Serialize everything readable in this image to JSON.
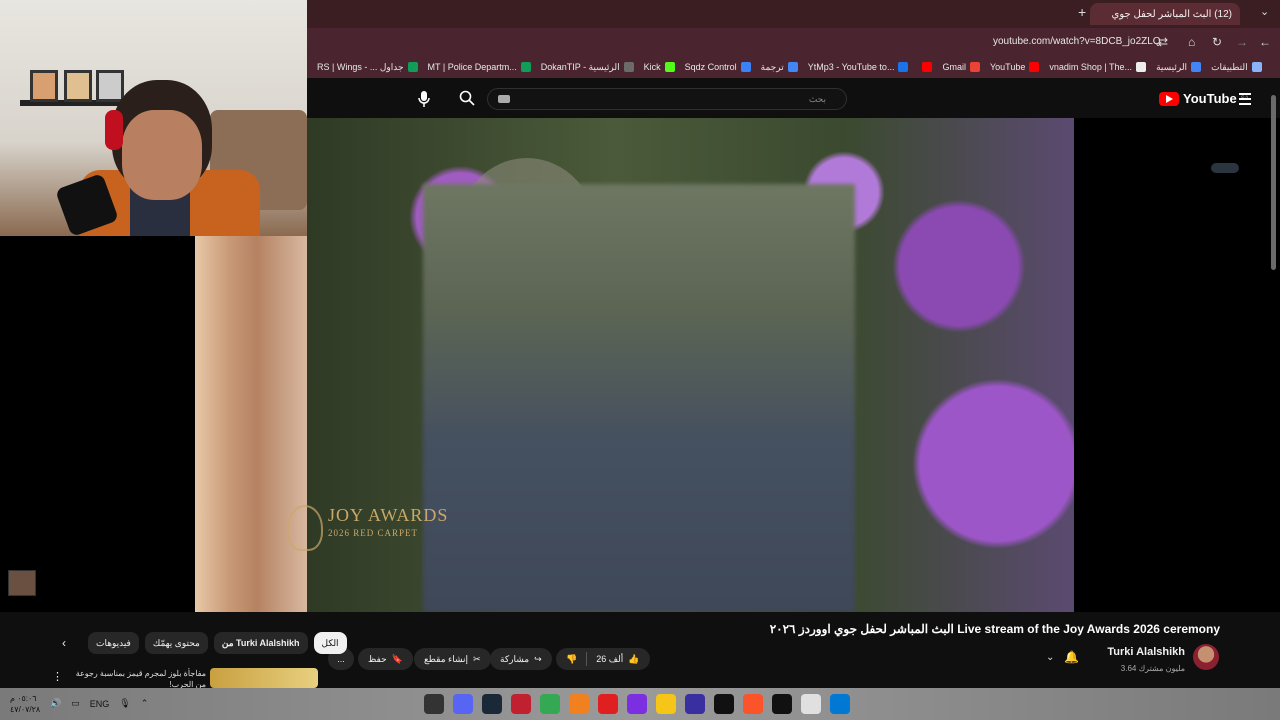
{
  "browser": {
    "tab_title": "(12) البث المباشر لحفل جوي",
    "url": "youtube.com/watch?v=8DCB_jo2ZLQ",
    "bookmarks": [
      {
        "label": "التطبيقات",
        "color": "#8ab4f8"
      },
      {
        "label": "الرئيسية",
        "color": "#4285f4"
      },
      {
        "label": "vnadim Shop | The...",
        "color": "#eeeeee"
      },
      {
        "label": "YouTube",
        "color": "#ff0000"
      },
      {
        "label": "Gmail",
        "color": "#ea4335"
      },
      {
        "label": "",
        "color": "#ff0000"
      },
      {
        "label": "YtMp3 - YouTube to...",
        "color": "#1a73e8"
      },
      {
        "label": "ترجمة",
        "color": "#4285f4"
      },
      {
        "label": "Sqdz Control",
        "color": "#3b82f6"
      },
      {
        "label": "Kick",
        "color": "#53fc18"
      },
      {
        "label": "DokanTIP - الرئيسية",
        "color": "#6b6b6b"
      },
      {
        "label": "MT | Police Departm...",
        "color": "#0f9d58"
      },
      {
        "label": "RS | Wings - ... جداول",
        "color": "#0f9d58"
      }
    ]
  },
  "youtube": {
    "logo": "YouTube",
    "region": "SA",
    "search_placeholder": "بحث",
    "title": "البث المباشر لحفل جوي اووردز ٢٠٢٦ Live stream of the Joy Awards 2026 ceremony",
    "channel_name": "Turki Alalshikh",
    "subscribers": "3.64 مليون مشترك",
    "likes": "26 ألف",
    "share_label": "مشاركة",
    "clip_label": "إنشاء مقطع",
    "save_label": "حفظ",
    "more_label": "...",
    "chips": [
      {
        "label": "الكل",
        "active": true
      },
      {
        "label": "من Turki Alalshikh",
        "active": false
      },
      {
        "label": "محتوى يهمّك",
        "active": false
      },
      {
        "label": "فيديوهات",
        "active": false
      }
    ],
    "rec_title": "مفاجأة بلوز لمجرم قيمز بمناسبة رجوعة من الحرب!",
    "overlay_logo": "JOY AWARDS",
    "overlay_sub": "2026 RED CARPET"
  },
  "taskbar": {
    "clock_time": "٠٥:٠٦ م",
    "clock_date": "٤٧/٠٧/٢٨",
    "lang": "ENG",
    "apps": [
      {
        "name": "obs-icon",
        "color": "#333333"
      },
      {
        "name": "discord-icon",
        "color": "#5865f2"
      },
      {
        "name": "steam-icon",
        "color": "#1b2838"
      },
      {
        "name": "voice-icon",
        "color": "#c02030"
      },
      {
        "name": "chrome-icon",
        "color": "#34a853"
      },
      {
        "name": "vlc-icon",
        "color": "#f08020"
      },
      {
        "name": "app-red-icon",
        "color": "#e02020"
      },
      {
        "name": "app-purple-icon",
        "color": "#7b2fe0"
      },
      {
        "name": "explorer-icon",
        "color": "#f5c518"
      },
      {
        "name": "cortana-icon",
        "color": "#3a2fa0"
      },
      {
        "name": "tiktok-icon",
        "color": "#111111"
      },
      {
        "name": "brave-icon",
        "color": "#fb542b"
      },
      {
        "name": "capcut-icon",
        "color": "#111111"
      },
      {
        "name": "store-icon",
        "color": "#e0e0e0"
      },
      {
        "name": "windows-icon",
        "color": "#0078d4"
      }
    ]
  }
}
